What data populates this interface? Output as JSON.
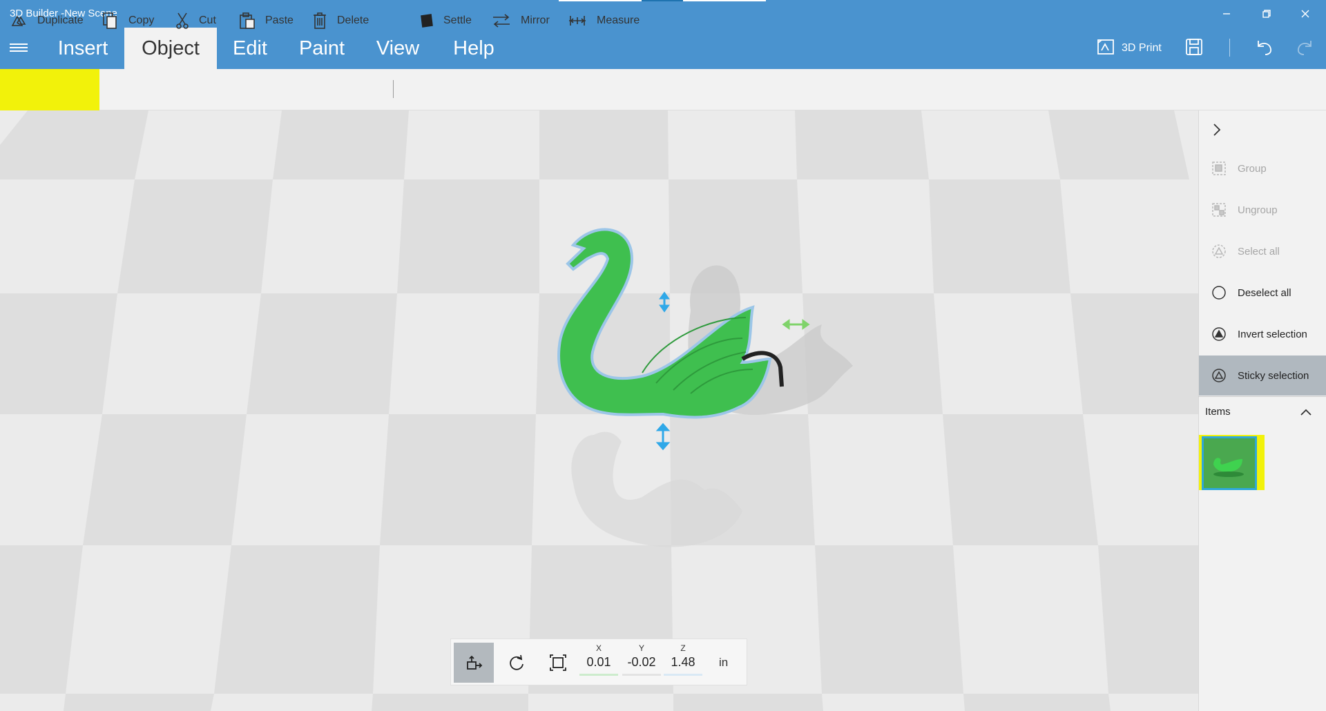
{
  "app": {
    "title": "3D Builder -New Scene"
  },
  "tabs": [
    "Insert",
    "Object",
    "Edit",
    "Paint",
    "View",
    "Help"
  ],
  "active_tab": "Object",
  "topbar": {
    "print_label": "3D Print"
  },
  "ribbon": {
    "duplicate": "Duplicate",
    "copy": "Copy",
    "cut": "Cut",
    "paste": "Paste",
    "delete": "Delete",
    "settle": "Settle",
    "mirror": "Mirror",
    "measure": "Measure"
  },
  "side_panel": {
    "group": "Group",
    "ungroup": "Ungroup",
    "select_all": "Select all",
    "deselect_all": "Deselect all",
    "invert_selection": "Invert selection",
    "sticky_selection": "Sticky selection",
    "items_label": "Items"
  },
  "transform_bar": {
    "x_label": "X",
    "y_label": "Y",
    "z_label": "Z",
    "x": "0.01",
    "y": "-0.02",
    "z": "1.48",
    "unit": "in"
  },
  "colors": {
    "titlebar": "#4a93cf",
    "highlight": "#f2f20a",
    "swan_green": "#3fbf4f",
    "handle_blue": "#2fa8e8",
    "handle_green": "#7fd36a"
  },
  "icons": {
    "menu": "hamburger-icon",
    "print": "3d-print-icon",
    "save": "save-icon",
    "undo": "undo-icon",
    "redo": "redo-icon"
  }
}
